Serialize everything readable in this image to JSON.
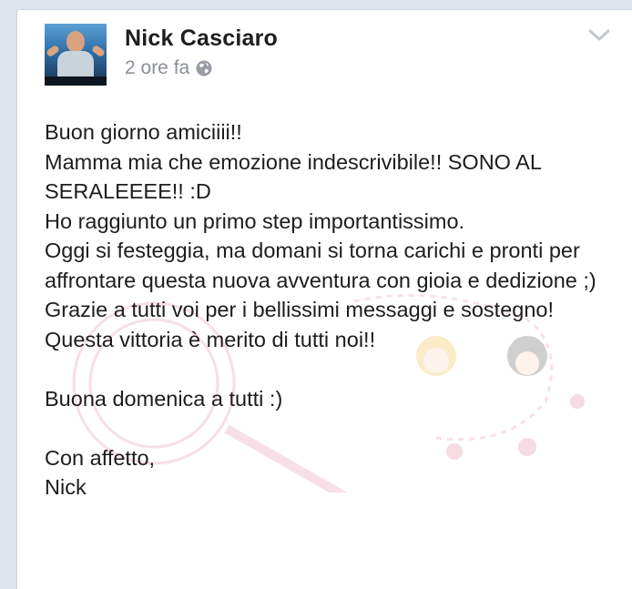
{
  "post": {
    "author": "Nick Casciaro",
    "time": "2 ore fa",
    "privacy_icon": "globe-icon",
    "menu_icon": "chevron-down-icon",
    "paragraphs": [
      "Buon giorno amiciiii!!",
      "Mamma mia che emozione indescrivibile!! SONO AL SERALEEEE!! :D",
      "Ho raggiunto un primo step importantissimo.",
      "Oggi si festeggia, ma domani si torna carichi e pronti per affrontare questa nuova avventura con gioia e dedizione ;)",
      "Grazie a tutti voi per i bellissimi messaggi e sostegno! Questa vittoria è merito di tutti noi!!",
      "Buona domenica a tutti :)",
      "Con affetto,",
      "Nick"
    ]
  },
  "colors": {
    "page_bg": "#dfe3ee",
    "card_bg": "#ffffff",
    "text": "#1d1d1d",
    "meta_text": "#8c8f96",
    "watermark_pink": "#e8a6b8"
  }
}
